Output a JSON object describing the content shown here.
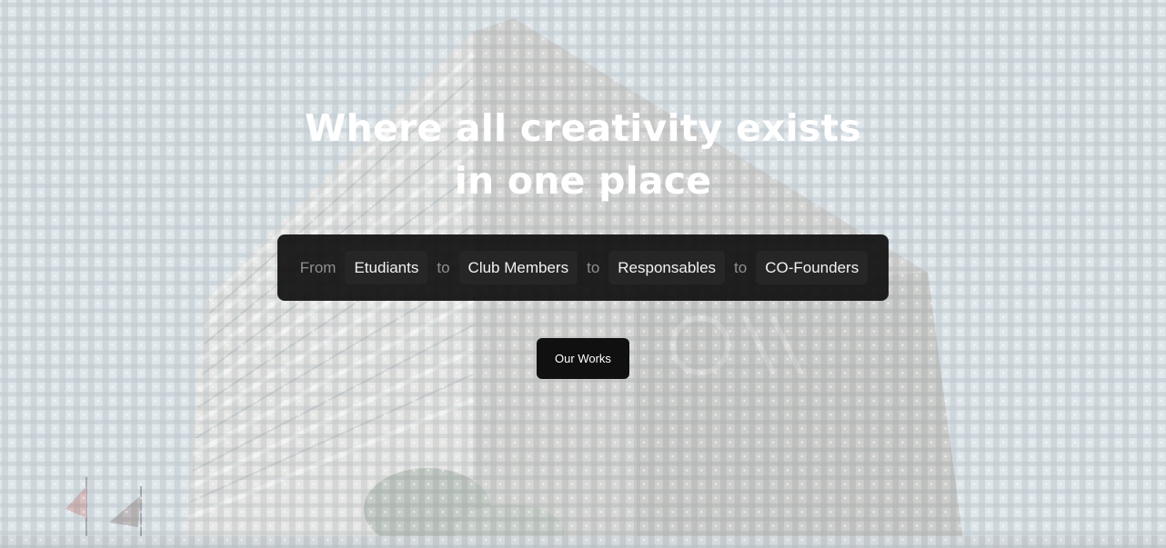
{
  "hero": {
    "headline_line1": "Where all creativity exists",
    "headline_line2": "in one place",
    "roles": {
      "from": "From",
      "connector": "to",
      "items": [
        "Etudiants",
        "Club Members",
        "Responsables",
        "CO-Founders"
      ]
    },
    "cta_label": "Our Works"
  },
  "colors": {
    "panel": "#0f0f0f",
    "chip": "#262626",
    "button": "#101010",
    "text_light": "#ffffff",
    "text_muted": "#8f8f8f"
  }
}
